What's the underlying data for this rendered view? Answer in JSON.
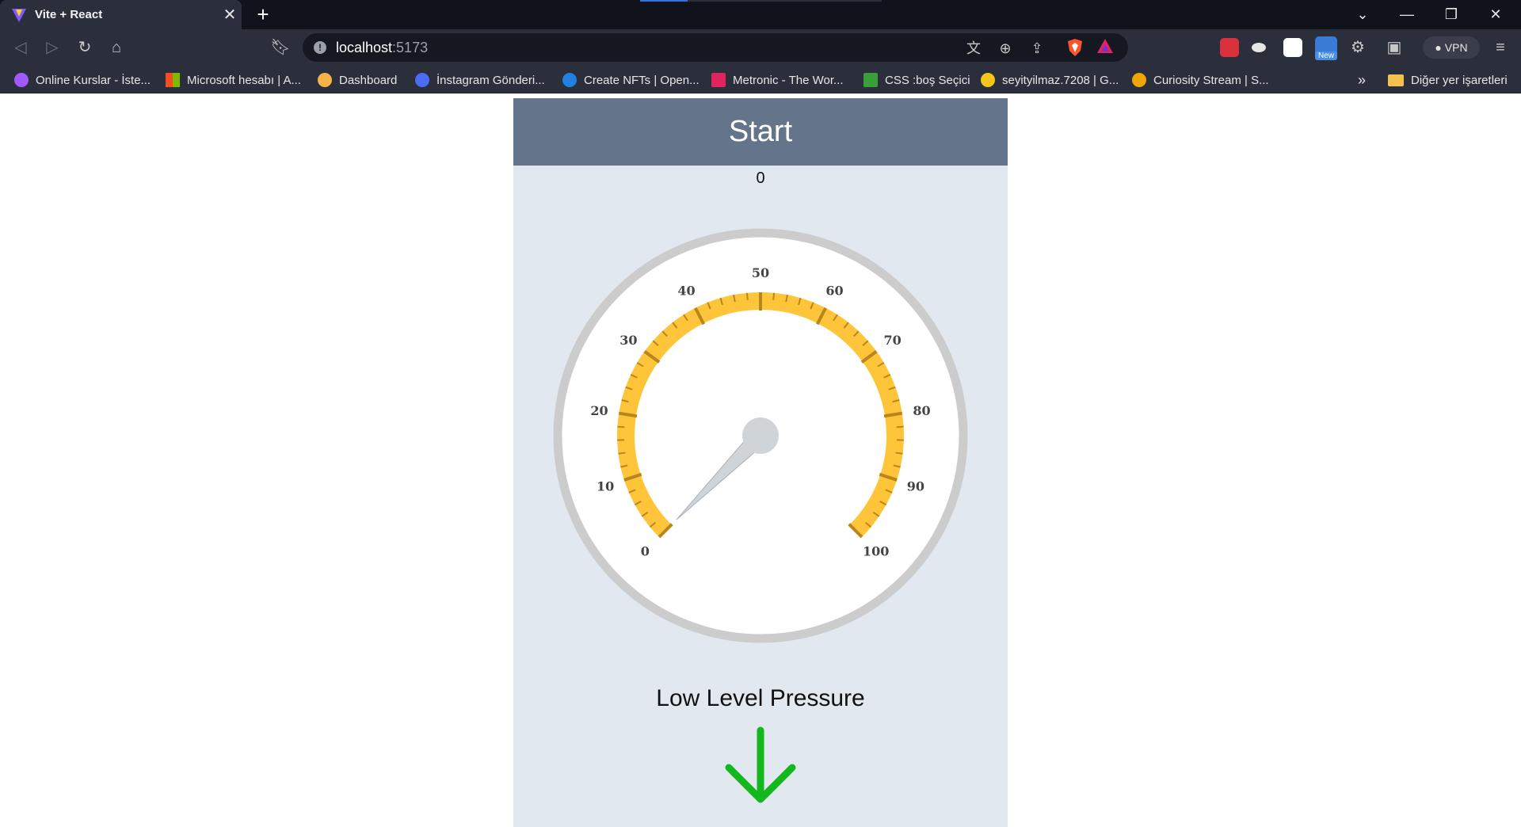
{
  "browser": {
    "tab_title": "Vite + React",
    "url_host": "localhost",
    "url_port": ":5173",
    "vpn_label": "VPN",
    "new_badge": "New",
    "bookmarks": [
      {
        "label": "Online Kurslar - İste...",
        "color": "#a259ff"
      },
      {
        "label": "Microsoft hesabı | A...",
        "color": "#f25022"
      },
      {
        "label": "Dashboard",
        "color": "#f7b248"
      },
      {
        "label": "İnstagram Gönderi...",
        "color": "#4a6cf7"
      },
      {
        "label": "Create NFTs | Open...",
        "color": "#2081e2"
      },
      {
        "label": "Metronic - The Wor...",
        "color": "#e0245e"
      },
      {
        "label": "CSS :boş Seçici",
        "color": "#3a9e3a"
      },
      {
        "label": "seyityilmaz.7208 | G...",
        "color": "#f5c518"
      },
      {
        "label": "Curiosity Stream | S...",
        "color": "#f0a500"
      }
    ],
    "bookmarks_overflow": "»",
    "other_bookmarks": "Diğer yer işaretleri"
  },
  "app": {
    "start_label": "Start",
    "value": "0",
    "status_label": "Low Level Pressure",
    "status_icon": "arrow-down-icon",
    "arrow_color": "#12b81d"
  },
  "gauge": {
    "min": 0,
    "max": 100,
    "value": 0,
    "tick_labels": [
      "0",
      "10",
      "20",
      "30",
      "40",
      "50",
      "60",
      "70",
      "80",
      "90",
      "100"
    ],
    "band_color": "#ffc53a",
    "tick_color": "#b8861a",
    "needle_color": "#cfd4d9",
    "rim_color": "#cccccc"
  }
}
